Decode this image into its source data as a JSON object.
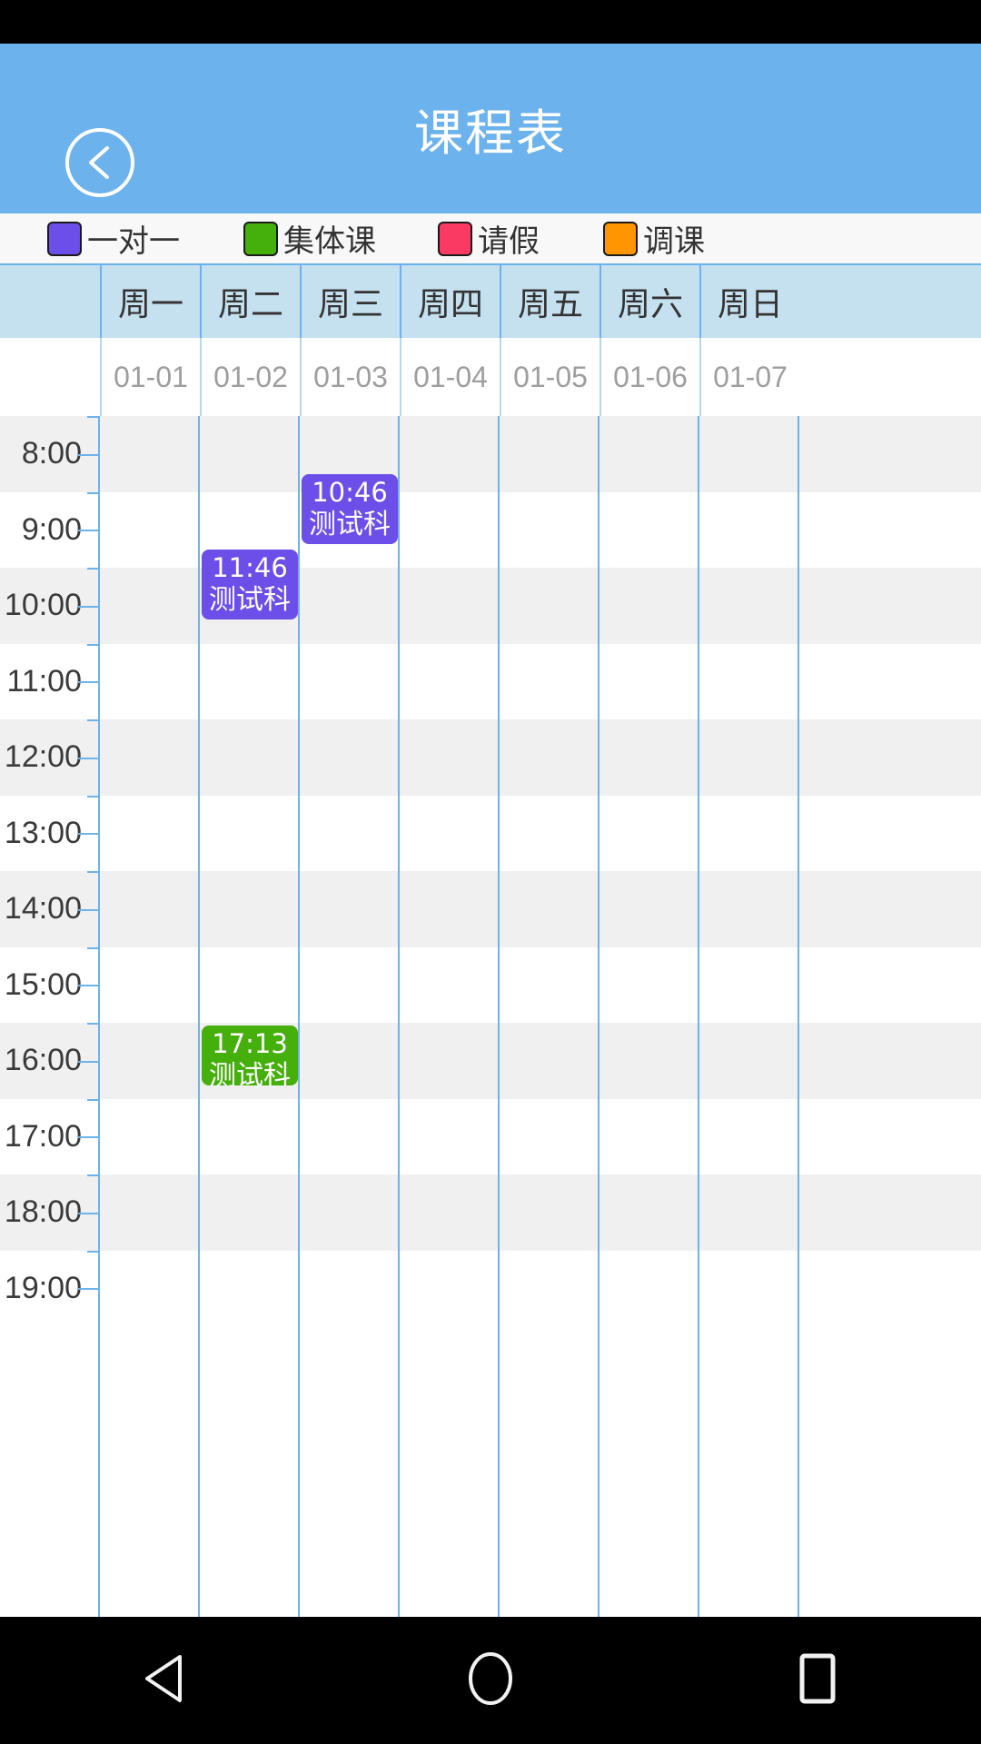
{
  "header": {
    "title": "课程表",
    "back_icon": "chevron-left-circle-icon",
    "background_color": "#6cb2ec"
  },
  "legend": {
    "items": [
      {
        "label": "一对一",
        "color": "#6c4fe8",
        "icon": "color-swatch-icon"
      },
      {
        "label": "集体课",
        "color": "#45af0b",
        "icon": "color-swatch-icon"
      },
      {
        "label": "请假",
        "color": "#fb3a63",
        "icon": "color-swatch-icon"
      },
      {
        "label": "调课",
        "color": "#ff9500",
        "icon": "color-swatch-icon"
      }
    ]
  },
  "calendar": {
    "weekdays": [
      "周一",
      "周二",
      "周三",
      "周四",
      "周五",
      "周六",
      "周日"
    ],
    "dates": [
      "01-01",
      "01-02",
      "01-03",
      "01-04",
      "01-05",
      "01-06",
      "01-07"
    ],
    "times": [
      "8:00",
      "9:00",
      "10:00",
      "11:00",
      "12:00",
      "13:00",
      "14:00",
      "15:00",
      "16:00",
      "17:00",
      "18:00",
      "19:00"
    ],
    "grid_line_color": "#6cb2ec",
    "header_background": "#c5e0ef",
    "events": [
      {
        "time": "10:46",
        "title": "测试科目a",
        "day_index": 2,
        "color": "#6c4fe8",
        "type": "一对一"
      },
      {
        "time": "11:46",
        "title": "测试科目a",
        "day_index": 1,
        "color": "#6c4fe8",
        "type": "一对一"
      },
      {
        "time": "17:13",
        "title": "测试科目a班",
        "day_index": 1,
        "color": "#45af0b",
        "type": "集体课"
      }
    ]
  },
  "nav_bar": {
    "buttons": [
      {
        "icon": "back-triangle-icon",
        "label": "返回"
      },
      {
        "icon": "home-circle-icon",
        "label": "主页"
      },
      {
        "icon": "recents-square-icon",
        "label": "最近任务"
      }
    ]
  }
}
